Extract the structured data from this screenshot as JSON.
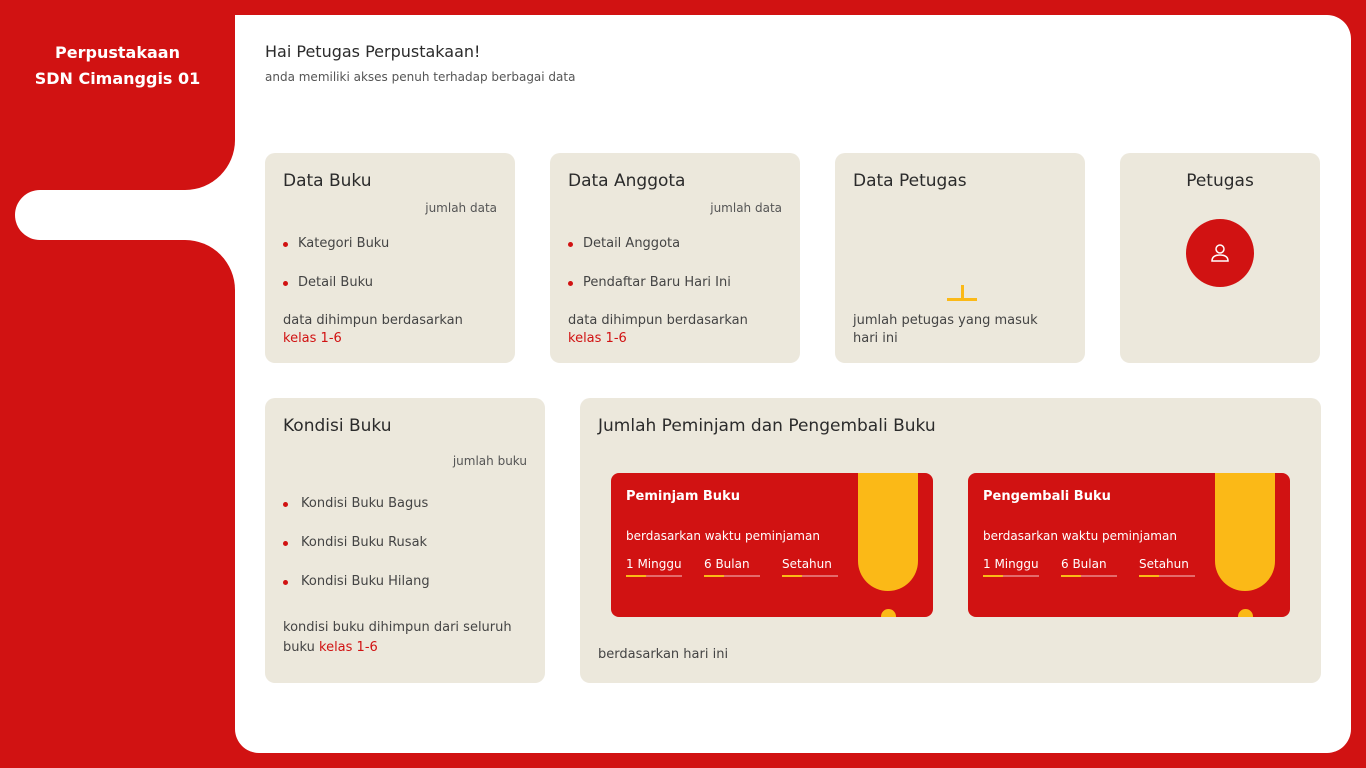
{
  "sidebar": {
    "brand_line1": "Perpustakaan",
    "brand_line2": "SDN Cimanggis 01"
  },
  "header": {
    "title": "Hai Petugas Perpustakaan!",
    "subtitle": "anda memiliki akses penuh terhadap berbagai data"
  },
  "cards": {
    "data_buku": {
      "title": "Data Buku",
      "meta": "jumlah data",
      "items": [
        "Kategori Buku",
        "Detail Buku"
      ],
      "note": "data dihimpun berdasarkan",
      "note_hl": "kelas 1-6"
    },
    "data_anggota": {
      "title": "Data Anggota",
      "meta": "jumlah data",
      "items": [
        "Detail Anggota",
        "Pendaftar Baru Hari Ini"
      ],
      "note": "data dihimpun berdasarkan",
      "note_hl": "kelas 1-6"
    },
    "data_petugas": {
      "title": "Data Petugas",
      "note_line1": "jumlah petugas yang masuk",
      "note_line2": "hari ini"
    },
    "petugas": {
      "title": "Petugas",
      "icon": "user-icon"
    },
    "kondisi_buku": {
      "title": "Kondisi Buku",
      "meta": "jumlah buku",
      "items": [
        "Kondisi Buku Bagus",
        "Kondisi Buku Rusak",
        "Kondisi Buku Hilang"
      ],
      "note_line1": "kondisi buku dihimpun dari seluruh",
      "note_line2": "buku",
      "note_hl": "kelas 1-6"
    },
    "jumlah": {
      "title": "Jumlah Peminjam dan Pengembali Buku",
      "footer": "berdasarkan hari ini",
      "peminjam": {
        "title": "Peminjam Buku",
        "sub": "berdasarkan waktu peminjaman",
        "periods": [
          "1 Minggu",
          "6 Bulan",
          "Setahun"
        ]
      },
      "pengembali": {
        "title": "Pengembali Buku",
        "sub": "berdasarkan waktu peminjaman",
        "periods": [
          "1 Minggu",
          "6 Bulan",
          "Setahun"
        ]
      }
    }
  },
  "colors": {
    "primary": "#d11212",
    "accent": "#fbb917",
    "card_bg": "#ece8dc"
  }
}
